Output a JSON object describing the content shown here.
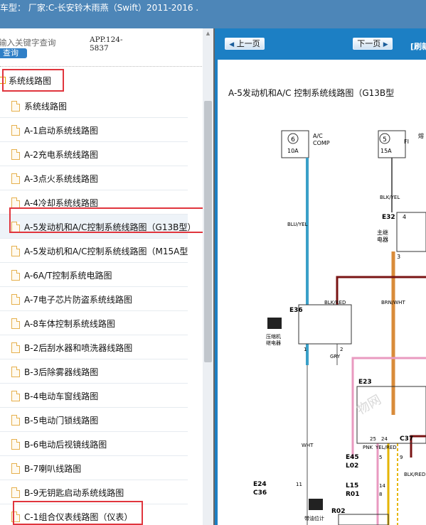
{
  "window": {
    "title": "车型：  厂家:C-长安铃木雨燕（Swift）2011-2016      ."
  },
  "search": {
    "placeholder": "输入关键字查询",
    "button_label": "查询",
    "app_version": "APP.124-5837"
  },
  "tree": {
    "root_label": "系统线路图",
    "items": [
      "系统线路图",
      "A-1启动系统线路图",
      "A-2充电系统线路图",
      "A-3点火系统线路图",
      "A-4冷却系统线路图",
      "A-5发动机和A/C控制系统线路图（G13B型）",
      "A-5发动机和A/C控制系统线路图（M15A型",
      "A-6A/T控制系统电路图",
      "A-7电子芯片防盗系统线路图",
      "A-8车体控制系统线路图",
      "B-2后刮水器和喷洗器线路图",
      "B-3后除雾器线路图",
      "B-4电动车窗线路图",
      "B-5电动门锁线路图",
      "B-6电动后视镜线路图",
      "B-7喇叭线路图",
      "B-9无钥匙启动系统线路图",
      "C-1组合仪表线路图（仪表）"
    ],
    "selected_index": 5
  },
  "viewer": {
    "prev_label": "上一页",
    "next_label": "下一页",
    "refresh_label": "[刷新",
    "page_title": "A-5发动机和A/C 控制系统线路图（G13B型",
    "fuse1": {
      "num": "6",
      "amp": "10A",
      "name1": "A/C",
      "name2": "COMP"
    },
    "fuse2": {
      "num": "5",
      "amp": "15A",
      "name": "FI",
      "extra": "熔"
    },
    "labels": {
      "e32": "E32",
      "e32_name1": "主继",
      "e32_name2": "电器",
      "pin4": "4",
      "pin3": "3",
      "blkyel": "BLK/YEL",
      "bluyel": "BLU/YEL",
      "blkred": "BLK/RED",
      "brnwht": "BRN/WHT",
      "e36": "E36",
      "e36_name1": "压缩机",
      "e36_name2": "继电器",
      "pin1": "1",
      "pin2": "2",
      "gry": "GRY",
      "e23": "E23",
      "c37": "C37",
      "wht": "WHT",
      "pnk": "PNK",
      "yelred": "YEL/RED",
      "blkred2": "BLK/RED",
      "e45": "E45",
      "l02": "L02",
      "l15": "L15",
      "r01": "R01",
      "e24": "E24",
      "c36": "C36",
      "r02": "R02",
      "r02_name": "带油位计",
      "pin5": "5",
      "pin9": "9",
      "pin24": "24",
      "pin25": "25",
      "pin11": "11",
      "pin14": "14",
      "pin8": "8",
      "watermark": "物网"
    }
  },
  "colors": {
    "topbar": "#4d86b8",
    "viewer_bg": "#1c7fc4",
    "highlight_box": "#e0353d",
    "wire_blue": "#3aa0c8",
    "wire_orange": "#d98b3a",
    "wire_red": "#7a1414",
    "wire_yellow": "#e5b500",
    "wire_pink": "#e99ac0"
  }
}
